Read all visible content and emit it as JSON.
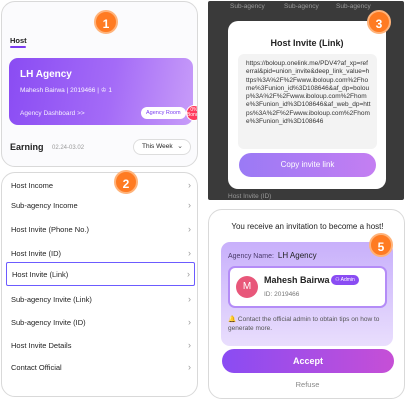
{
  "panel1": {
    "tab": "Host",
    "agency": {
      "name": "LH Agency",
      "meta": "Mahesh Bairwa | 2019466 | ♔ 1",
      "dashboard_link": "Agency Dashboard >>",
      "room_button": "Agency Room",
      "pct_badge": "0% Bonus"
    },
    "earning": {
      "label": "Earning",
      "date_range": "02.24-03.02",
      "period": "This Week"
    }
  },
  "panel2": {
    "menu": [
      {
        "label": "Host Income"
      },
      {
        "label": "Sub-agency Income"
      },
      {
        "label": "Host Invite (Phone No.)"
      },
      {
        "label": "Host Invite (ID)"
      },
      {
        "label": "Host Invite (Link)",
        "highlighted": true
      },
      {
        "label": "Sub-agency Invite (Link)"
      },
      {
        "label": "Sub-agency Invite (ID)"
      },
      {
        "label": "Host Invite Details"
      },
      {
        "label": "Contact Official"
      }
    ],
    "chevron": "›"
  },
  "panel3": {
    "bg_labels": [
      "Sub-agency",
      "Sub-agency",
      "Sub-agency",
      "Host Invite (ID)"
    ],
    "modal_title": "Host Invite (Link)",
    "link": "https://boloup.onelink.me/PDV4?af_xp=referral&pid=union_invite&deep_link_value=https%3A%2F%2Fwww.iboloup.com%2Fhome%3Funion_id%3D108646&af_dp=boloup%3A%2F%2Fwww.iboloup.com%2Fhome%3Funion_id%3D108646&af_web_dp=https%3A%2F%2Fwww.iboloup.com%2Fhome%3Funion_id%3D108646",
    "copy_button": "Copy invite link"
  },
  "panel5": {
    "heading": "You receive an invitation to become a host!",
    "agency_label": "Agency Name:",
    "agency_name": "LH Agency",
    "avatar_letter": "M",
    "user_name": "Mahesh Bairwa",
    "admin_badge": "Admin",
    "user_id": "ID: 2019466",
    "hint": "🔔 Contact the official admin to obtain tips on how to generate more.",
    "accept_button": "Accept",
    "refuse_button": "Refuse"
  },
  "steps": [
    "1",
    "2",
    "3",
    "5"
  ],
  "colors": {
    "accent": "#8a4cf3",
    "step": "#ff7b22",
    "highlight_border": "#6c5bff"
  }
}
